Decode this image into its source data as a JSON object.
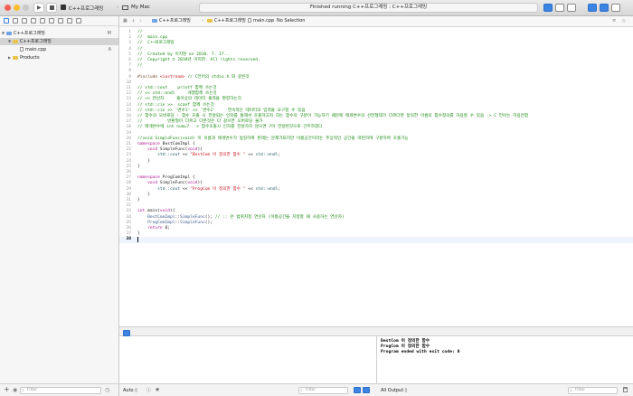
{
  "toolbar": {
    "scheme": "C++프로그래밍",
    "destination": "My Mac",
    "status": "Finished running C++프로그래밍 : C++프로그래밍"
  },
  "navigator": {
    "items": [
      {
        "label": "C++프로그래밍",
        "badge": "M"
      },
      {
        "label": "C++프로그래밍",
        "badge": ""
      },
      {
        "label": "main.cpp",
        "badge": "A"
      },
      {
        "label": "Products",
        "badge": ""
      }
    ],
    "filter_placeholder": "Filter"
  },
  "jumpbar": {
    "project": "C++프로그래밍",
    "group": "C++프로그래밍",
    "file": "main.cpp",
    "selection": "No Selection"
  },
  "editor": {
    "lines": [
      "//",
      "//  main.cpp",
      "//  C++프로그래밍",
      "//",
      "//  Created by 이지현 on 2018. 7. 17..",
      "//  Copyright © 2018년 이지현. All rights reserved.",
      "//",
      "",
      "#include <iostream> // C언어의 stdio.h 와 같은것",
      "",
      "// std::cout    printf 함께 쓰는것",
      "// << std::endl     개행함께 쓰는것",
      "// << 연산자     출이상의 데이터 출력을 명령하는것",
      "// std::cin >>  scanf 함께 쓰는것",
      "// std::cin >> '변수1' >> '변수2'     연속적인 데이터의 입력을 요구할 수 있음",
      "// 함수의 오버로딩 : 함수 호출 시 전달되는 인자를 통해서 호출하고자 하는 함수의 구분이 가능하기 때문에 매개변수의 선언형태가 다르다면 동일한 이름의 함수정의를 허용할 수 있음 -> C 언어는 허용안함",
      "//          반환형이 다르고 다른것은 다 같으면 오버로딩 불가",
      "// 매개변수에 int num=7  -> 함수호출시 인자를 전달하지 않으면 7이 전달된것으로 간주하겠다",
      "",
      "//void SimpleFunc(void) 이 이름과 매개변수가 동일하여 본래는 문제가되지만 이름공간이라는 추상적인 공간을 마련하여 구분하여 호출가능",
      "namespace BestComImpl {",
      "    void SimpleFunc(void){",
      "        std::cout << \"BestCom 이 정의한 함수 \" << std::endl;",
      "    }",
      "}",
      "",
      "namespace ProgComImpl {",
      "    void SimpleFunc(void){",
      "        std::cout << \"ProgCom 이 정의한 함수 \" << std::endl;",
      "    }",
      "}",
      "",
      "int main(void){",
      "    BestComImpl::SimpleFunc(); // :: 은 범위지정 연산자 (이름공간을 지정할 때 사용하는 연산자)",
      "    ProgComImpl::SimpleFunc();",
      "    return 0;",
      "}",
      ""
    ]
  },
  "debug": {
    "auto_label": "Auto ◊",
    "filter_placeholder": "Filter",
    "all_output_label": "All Output ◊",
    "console_lines": [
      "BestCom 이 정의한 함수",
      "ProgCom 이 정의한 함수",
      "Program ended with exit code: 0"
    ]
  }
}
